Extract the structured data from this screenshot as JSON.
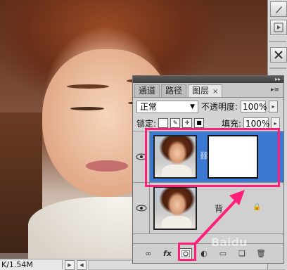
{
  "statusbar": {
    "doc_size": "K/1.54M"
  },
  "panel": {
    "tabs": [
      {
        "label": "通道",
        "active": false
      },
      {
        "label": "路径",
        "active": false
      },
      {
        "label": "图层",
        "active": true,
        "close_glyph": "×"
      }
    ],
    "menu_glyph": "▸≡",
    "collapse_glyph": "▸▸",
    "blend_mode": "正常",
    "opacity_label": "不透明度:",
    "opacity_value": "100%",
    "lock_label": "锁定:",
    "fill_label": "填充:",
    "fill_value": "100%",
    "layers": [
      {
        "name": "",
        "selected": true,
        "has_mask": true
      },
      {
        "name": "背",
        "selected": false,
        "locked": true
      }
    ],
    "bottom_buttons": {
      "link": "∞",
      "fx": "fx",
      "mask": "add-layer-mask",
      "adjust": "adjustment",
      "group": "group",
      "new": "new-layer",
      "delete": "delete"
    }
  },
  "highlight_color": "#ff1f78",
  "selected_layer_color": "#3b78d1",
  "watermark": "Baidu"
}
